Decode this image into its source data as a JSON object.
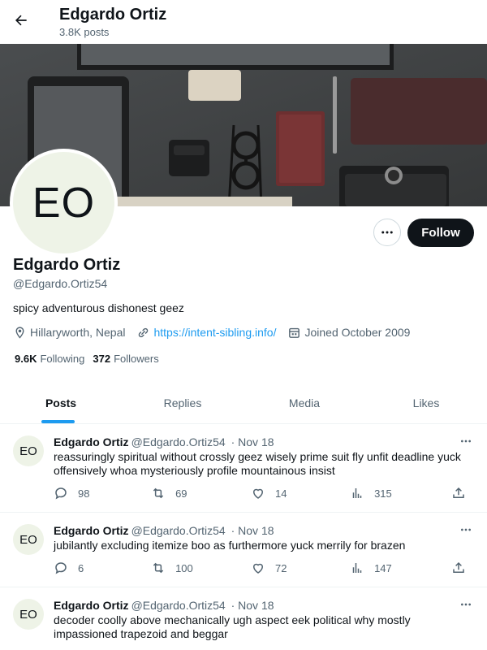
{
  "header": {
    "name": "Edgardo Ortiz",
    "post_count": "3.8K posts"
  },
  "profile": {
    "avatar_initials": "EO",
    "name": "Edgardo Ortiz",
    "handle": "@Edgardo.Ortiz54",
    "bio": "spicy adventurous dishonest geez",
    "location": "Hillaryworth, Nepal",
    "website": "https://intent-sibling.info/",
    "joined": "Joined October 2009",
    "following_count": "9.6K",
    "following_label": "Following",
    "followers_count": "372",
    "followers_label": "Followers",
    "follow_button": "Follow"
  },
  "tabs": [
    {
      "label": "Posts",
      "active": true
    },
    {
      "label": "Replies",
      "active": false
    },
    {
      "label": "Media",
      "active": false
    },
    {
      "label": "Likes",
      "active": false
    }
  ],
  "posts": [
    {
      "avatar": "EO",
      "name": "Edgardo Ortiz",
      "handle": "@Edgardo.Ortiz54",
      "date": "· Nov 18",
      "text": "reassuringly spiritual without crossly geez wisely prime suit fly unfit deadline yuck offensively whoa mysteriously profile mountainous insist",
      "replies": "98",
      "reposts": "69",
      "likes": "14",
      "views": "315"
    },
    {
      "avatar": "EO",
      "name": "Edgardo Ortiz",
      "handle": "@Edgardo.Ortiz54",
      "date": "· Nov 18",
      "text": "jubilantly excluding itemize boo as furthermore yuck merrily for brazen",
      "replies": "6",
      "reposts": "100",
      "likes": "72",
      "views": "147"
    },
    {
      "avatar": "EO",
      "name": "Edgardo Ortiz",
      "handle": "@Edgardo.Ortiz54",
      "date": "· Nov 18",
      "text": "decoder coolly above mechanically ugh aspect eek political why mostly impassioned trapezoid and beggar"
    }
  ],
  "colors": {
    "accent": "#1d9bf0",
    "text_primary": "#0f1419",
    "text_secondary": "#536471",
    "avatar_bg": "#eef3e7"
  }
}
